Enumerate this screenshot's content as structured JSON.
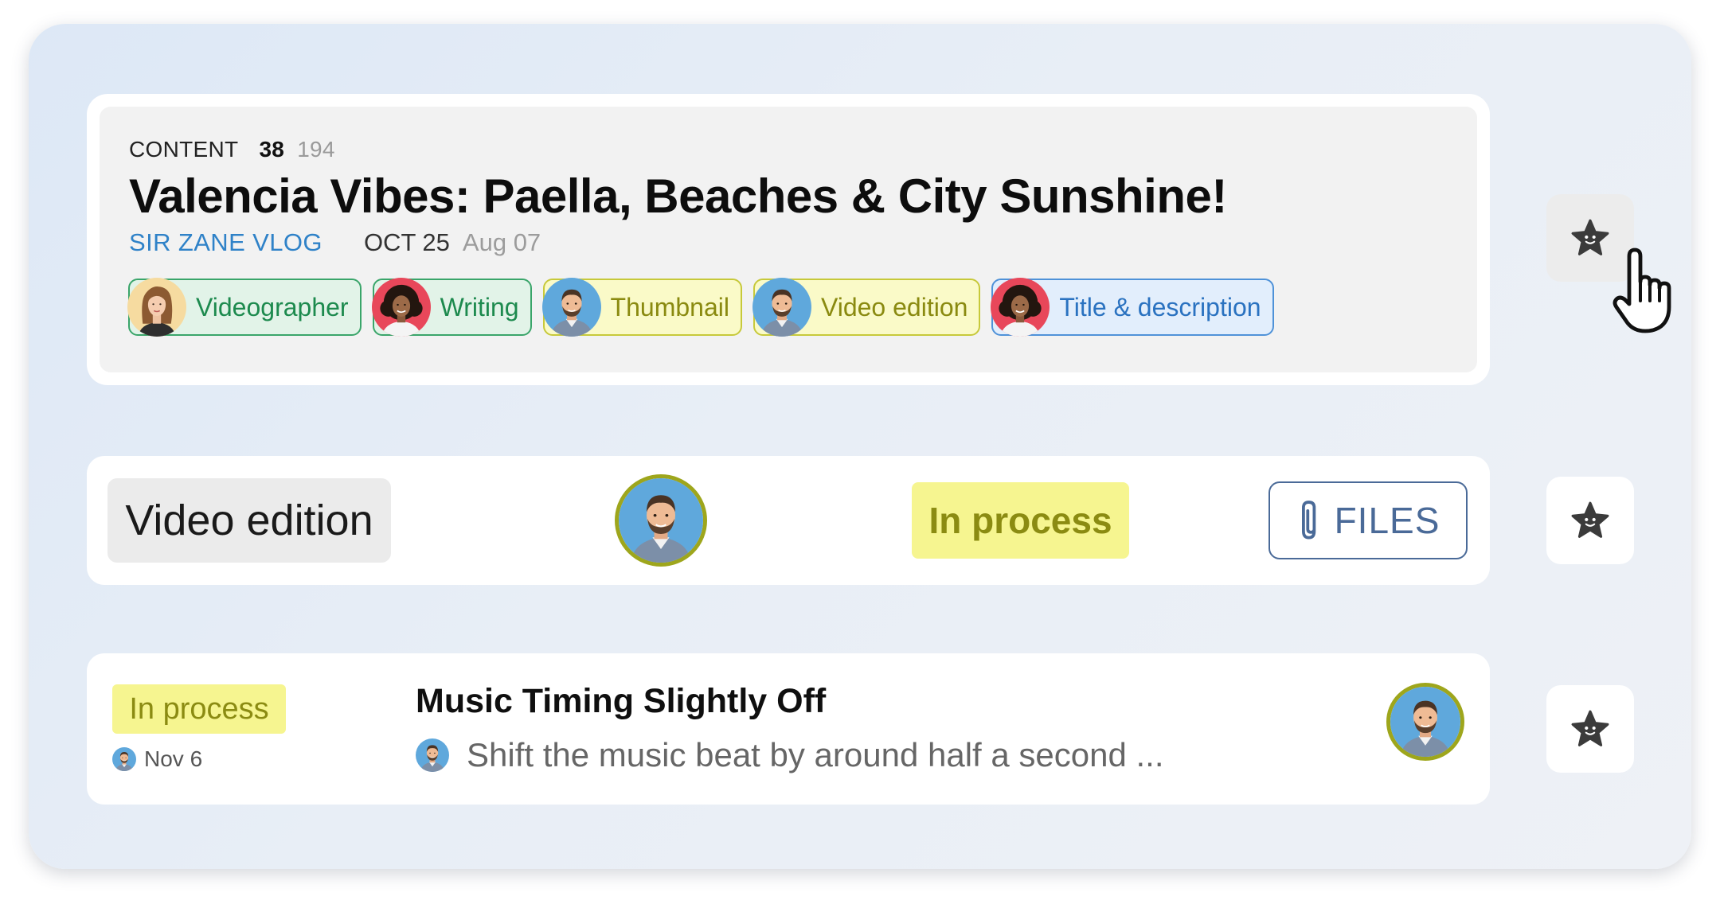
{
  "content_card": {
    "section_label": "CONTENT",
    "count_primary": "38",
    "count_secondary": "194",
    "title": "Valencia Vibes: Paella, Beaches & City Sunshine!",
    "channel": "SIR ZANE VLOG",
    "date_primary": "OCT 25",
    "date_secondary": "Aug 07",
    "chips": [
      {
        "label": "Videographer",
        "color": "green",
        "avatar": "woman-blonde"
      },
      {
        "label": "Writing",
        "color": "green",
        "avatar": "woman-curly"
      },
      {
        "label": "Thumbnail",
        "color": "yellow",
        "avatar": "man-beard"
      },
      {
        "label": "Video edition",
        "color": "yellow",
        "avatar": "man-beard"
      },
      {
        "label": "Title & description",
        "color": "blue",
        "avatar": "woman-curly"
      }
    ]
  },
  "task_row": {
    "task_label": "Video edition",
    "status": "In process",
    "files_label": "FILES"
  },
  "comment_row": {
    "status": "In process",
    "date": "Nov 6",
    "title": "Music Timing Slightly Off",
    "preview": "Shift the music beat by around half a second ..."
  },
  "icons": {
    "star": "star-icon",
    "paperclip": "paperclip-icon",
    "cursor": "hand-pointer-icon"
  },
  "colors": {
    "accent_blue": "#2f82c8",
    "status_yellow_bg": "#f6f590",
    "status_yellow_text": "#8b8b12",
    "chip_green": "#3aa56a",
    "chip_yellow": "#c7c93a",
    "chip_blue": "#4f92d8"
  }
}
